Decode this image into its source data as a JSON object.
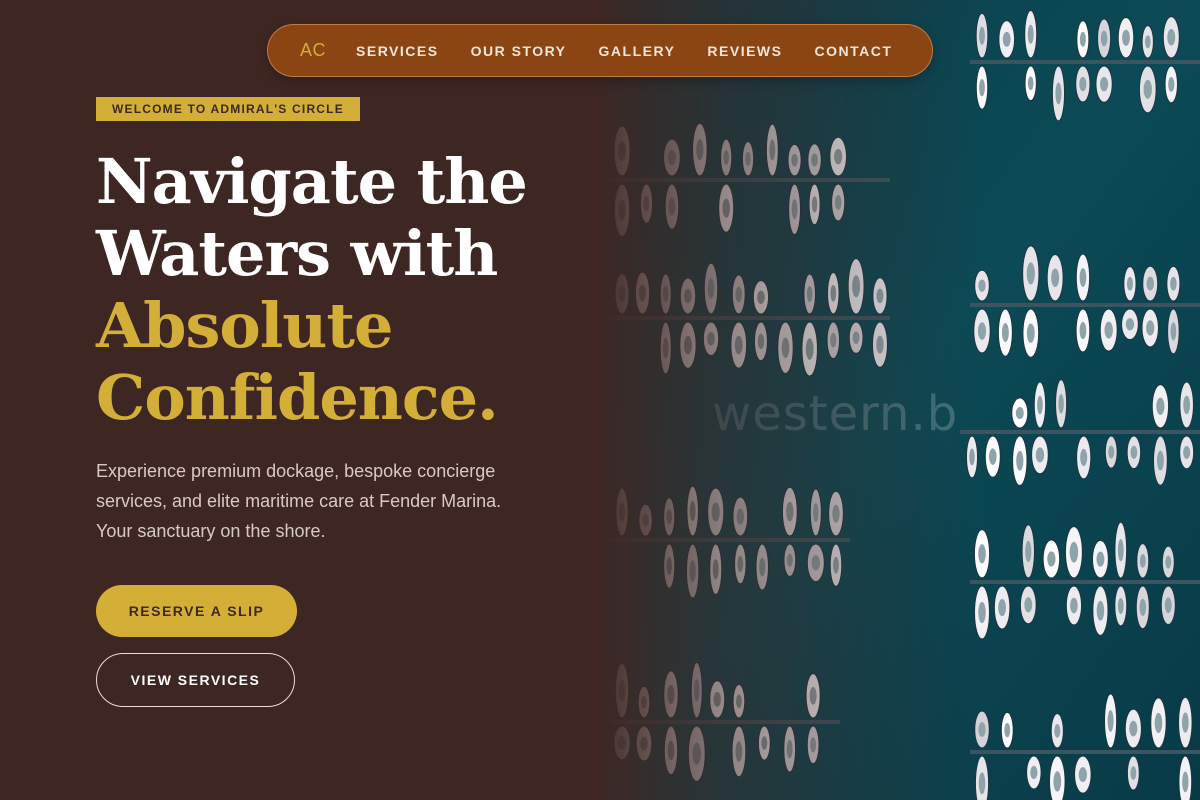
{
  "nav": {
    "logo": "AC",
    "links": [
      "SERVICES",
      "OUR STORY",
      "GALLERY",
      "REVIEWS",
      "CONTACT"
    ]
  },
  "hero": {
    "badge": "WELCOME TO ADMIRAL'S CIRCLE",
    "headline_lines": [
      "Navigate the",
      "Waters with",
      "Absolute",
      "Confidence."
    ],
    "description": "Experience premium dockage, bespoke concierge services, and elite maritime care at Fender Marina. Your sanctuary on the shore.",
    "primary_button": "RESERVE A SLIP",
    "secondary_button": "VIEW SERVICES"
  },
  "image": {
    "watermark": "western.b",
    "subject": "aerial-marina-boats"
  },
  "colors": {
    "background": "#3e2723",
    "accent_gold": "#d4af37",
    "nav_brown": "#8b4513",
    "water": "#0b4a56"
  }
}
